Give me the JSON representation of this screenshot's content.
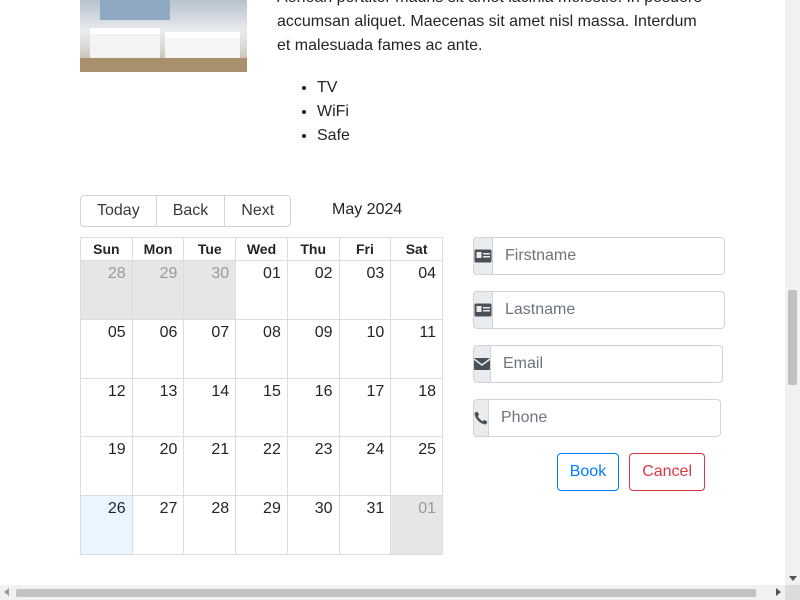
{
  "room": {
    "description": "Aenean porttitor mauris sit amet lacinia molestie. In posuere accumsan aliquet. Maecenas sit amet nisl massa. Interdum et malesuada fames ac ante.",
    "amenities": [
      "TV",
      "WiFi",
      "Safe"
    ]
  },
  "calendar": {
    "toolbar": {
      "today": "Today",
      "back": "Back",
      "next": "Next"
    },
    "month_label": "May 2024",
    "weekdays": [
      "Sun",
      "Mon",
      "Tue",
      "Wed",
      "Thu",
      "Fri",
      "Sat"
    ],
    "weeks": [
      [
        "28",
        "29",
        "30",
        "01",
        "02",
        "03",
        "04"
      ],
      [
        "05",
        "06",
        "07",
        "08",
        "09",
        "10",
        "11"
      ],
      [
        "12",
        "13",
        "14",
        "15",
        "16",
        "17",
        "18"
      ],
      [
        "19",
        "20",
        "21",
        "22",
        "23",
        "24",
        "25"
      ],
      [
        "26",
        "27",
        "28",
        "29",
        "30",
        "31",
        "01"
      ]
    ]
  },
  "booking_form": {
    "firstname_placeholder": "Firstname",
    "lastname_placeholder": "Lastname",
    "email_placeholder": "Email",
    "phone_placeholder": "Phone",
    "book_label": "Book",
    "cancel_label": "Cancel"
  },
  "colors": {
    "primary": "#007bff",
    "danger": "#dc3545",
    "off_range_day": "#e6e6e6",
    "today_highlight": "#eaf6ff"
  }
}
